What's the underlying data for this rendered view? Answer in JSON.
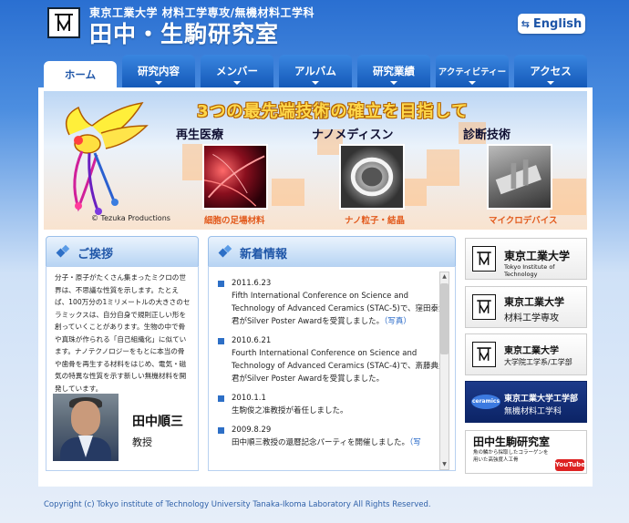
{
  "header": {
    "department": "東京工業大学 材料工学専攻/無機材料工学科",
    "lab_title": "田中・生駒研究室",
    "english_button": "English"
  },
  "nav": {
    "tabs": [
      {
        "label": "ホーム",
        "active": true
      },
      {
        "label": "研究内容"
      },
      {
        "label": "メンバー"
      },
      {
        "label": "アルバム"
      },
      {
        "label": "研究業績"
      },
      {
        "label": "アクティビティー"
      },
      {
        "label": "アクセス"
      }
    ]
  },
  "banner": {
    "headline": "3つの最先端技術の確立を目指して",
    "credit": "© Tezuka Productions",
    "fields": [
      {
        "label": "再生医療",
        "caption": "細胞の足場材料"
      },
      {
        "label": "ナノメディスン",
        "caption": "ナノ粒子・結晶"
      },
      {
        "label": "診断技術",
        "caption": "マイクロデバイス"
      }
    ]
  },
  "greeting": {
    "title": "ご挨拶",
    "text": "分子・原子がたくさん集まったミクロの世界は、不思議な性質を示します。たとえば、100万分の1ミリメートルの大きさのセラミックスは、自分自身で規則正しい形を創っていくことがあります。生物の中で骨や真珠が作られる「自己組織化」に似ています。ナノテクノロジーをもとに本当の骨や歯骨を再生する材料をはじめ、電気・磁気の特異な性質を示す新しい無機材料を開発しています。",
    "name": "田中順三",
    "position": "教授"
  },
  "news": {
    "title": "新着情報",
    "items": [
      {
        "date": "2011.6.23",
        "text": "Fifth International Conference on Science and Technology of Advanced Ceramics (STAC-5)で、窪田泰大君がSilver Poster Awardを受賞しました。",
        "link": "（写真）"
      },
      {
        "date": "2010.6.21",
        "text": "Fourth International Conference on Science and Technology of Advanced Ceramics (STAC-4)で、斎藤典生君がSilver Poster Awardを受賞しました。",
        "link": ""
      },
      {
        "date": "2010.1.1",
        "text": "生駒俊之准教授が着任しました。",
        "link": ""
      },
      {
        "date": "2009.8.29",
        "text": "田中順三教授の還暦記念パーティを開催しました。",
        "link": "（写"
      }
    ]
  },
  "side_links": [
    {
      "line1": "東京工業大学",
      "line2": "Tokyo Institute of Technology"
    },
    {
      "line1": "東京工業大学",
      "line2": "材料工学専攻"
    },
    {
      "line1": "東京工業大学",
      "line2": "大学院工学系/工学部"
    },
    {
      "badge": "ceramics",
      "line1": "東京工業大学工学部",
      "line2": "無機材料工学科"
    },
    {
      "line1": "田中生駒研究室",
      "line2": "魚の鱗から採取したコラーゲンを用いた高強度人工骨",
      "badge2": "YouTube"
    }
  ],
  "footer": {
    "copyright": "Copyright (c) Tokyo institute of Technology University Tanaka-Ikoma Laboratory All Rights Reserved."
  },
  "colors": {
    "accent": "#1f56a8",
    "nav_tab": "#2c79d6",
    "banner_gold": "#ffd84a",
    "caption_orange": "#e25a1c"
  }
}
